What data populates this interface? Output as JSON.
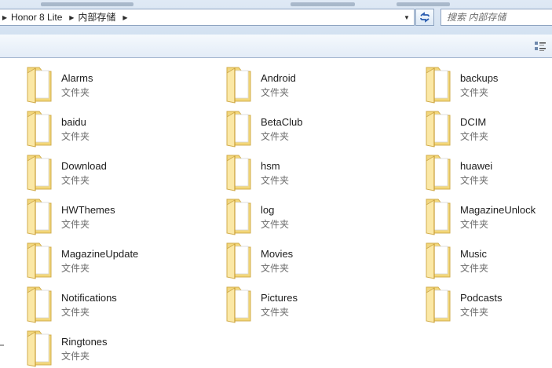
{
  "address": {
    "crumbs": [
      {
        "label": "Honor 8 Lite"
      },
      {
        "label": "内部存储"
      }
    ]
  },
  "search": {
    "placeholder": "搜索 内部存储"
  },
  "icons": {
    "folder": "folder-icon",
    "refresh": "refresh-icon",
    "view": "view-options-icon",
    "chevron": "chevron-right-icon",
    "dropdown": "chevron-down-icon"
  },
  "colors": {
    "folder_body": "#f3d77a",
    "folder_front": "#fbe8a6",
    "accent": "#2a5db0"
  },
  "folders": [
    {
      "name": "Alarms",
      "type": "文件夹"
    },
    {
      "name": "Android",
      "type": "文件夹"
    },
    {
      "name": "backups",
      "type": "文件夹"
    },
    {
      "name": "baidu",
      "type": "文件夹"
    },
    {
      "name": "BetaClub",
      "type": "文件夹"
    },
    {
      "name": "DCIM",
      "type": "文件夹"
    },
    {
      "name": "Download",
      "type": "文件夹"
    },
    {
      "name": "hsm",
      "type": "文件夹"
    },
    {
      "name": "huawei",
      "type": "文件夹"
    },
    {
      "name": "HWThemes",
      "type": "文件夹"
    },
    {
      "name": "log",
      "type": "文件夹"
    },
    {
      "name": "MagazineUnlock",
      "type": "文件夹"
    },
    {
      "name": "MagazineUpdate",
      "type": "文件夹"
    },
    {
      "name": "Movies",
      "type": "文件夹"
    },
    {
      "name": "Music",
      "type": "文件夹"
    },
    {
      "name": "Notifications",
      "type": "文件夹"
    },
    {
      "name": "Pictures",
      "type": "文件夹"
    },
    {
      "name": "Podcasts",
      "type": "文件夹"
    },
    {
      "name": "Ringtones",
      "type": "文件夹"
    }
  ]
}
